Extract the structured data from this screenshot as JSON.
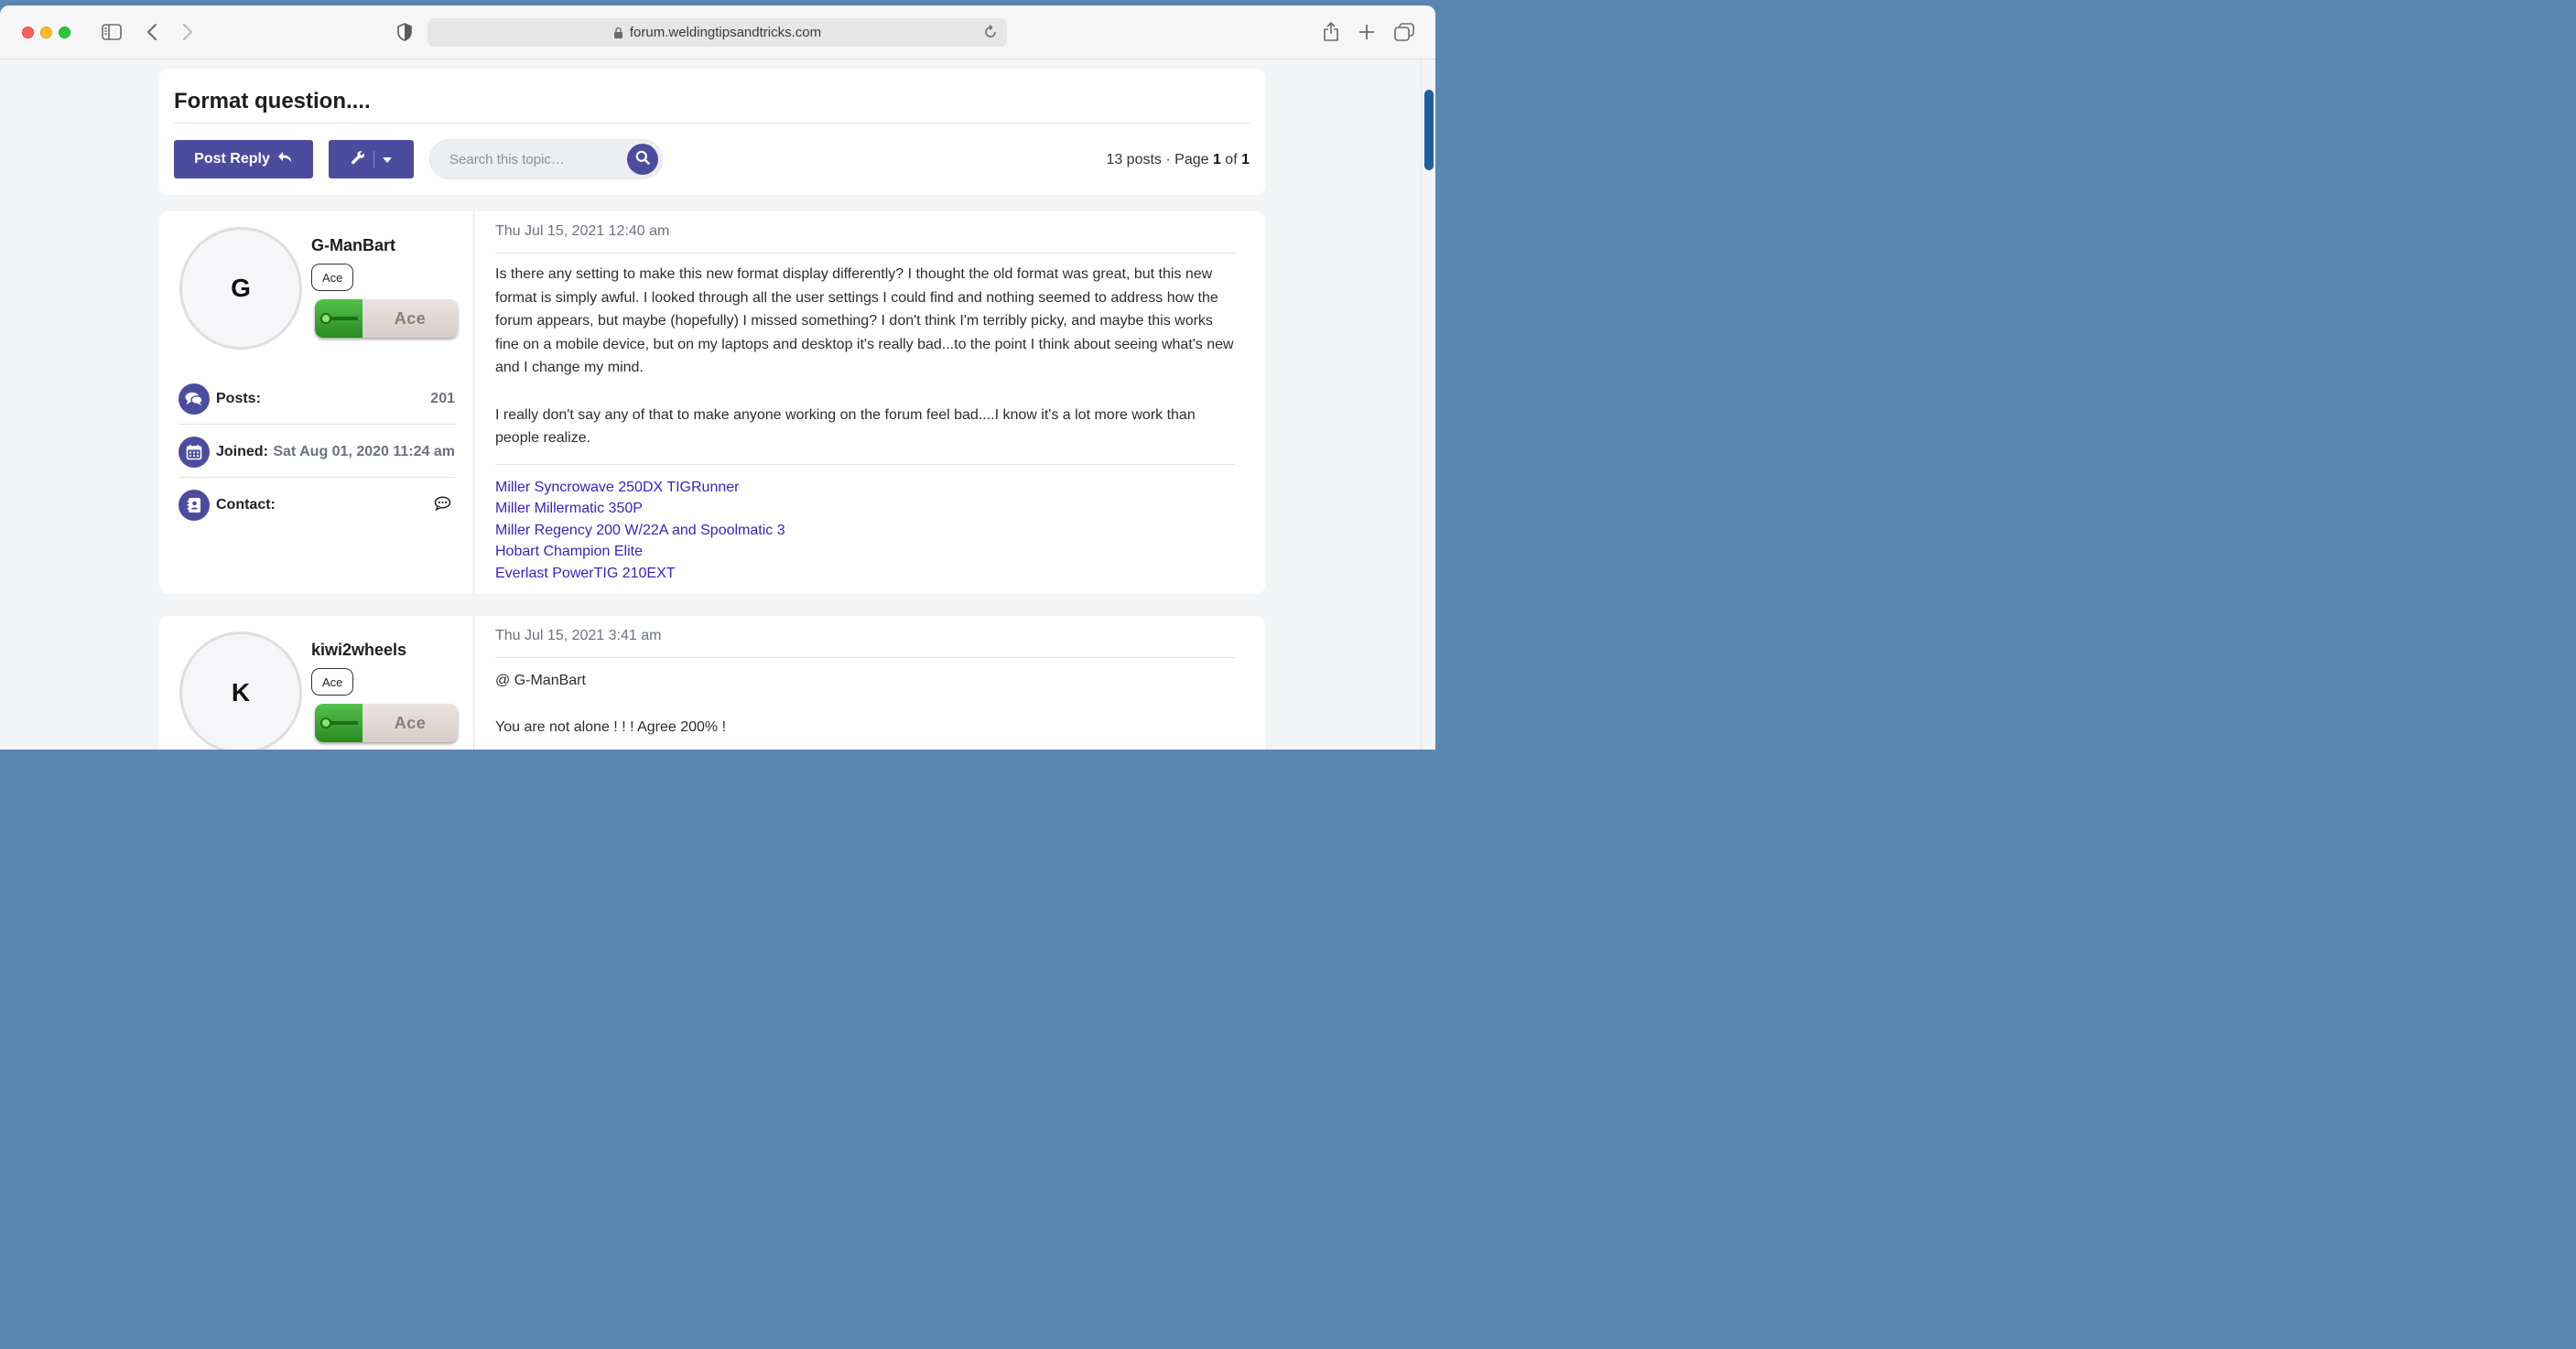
{
  "browser": {
    "url": "forum.weldingtipsandtricks.com"
  },
  "topic": {
    "title": "Format question....",
    "post_reply_label": "Post Reply",
    "search_placeholder": "Search this topic…",
    "pagination": {
      "posts": "13 posts",
      "sep": " · Page ",
      "page": "1",
      "of": " of ",
      "total": "1"
    }
  },
  "posts": [
    {
      "avatar_letter": "G",
      "username": "G-ManBart",
      "rank": "Ace",
      "rank_image_label": "Ace",
      "stats": {
        "posts_label": "Posts:",
        "posts_value": "201",
        "joined_label": "Joined:",
        "joined_value": "Sat Aug 01, 2020 11:24 am",
        "contact_label": "Contact:"
      },
      "date": "Thu Jul 15, 2021 12:40 am",
      "paragraphs": [
        "Is there any setting to make this new format display differently? I thought the old format was great, but this new format is simply awful. I looked through all the user settings I could find and nothing seemed to address how the forum appears, but maybe (hopefully) I missed something? I don't think I'm terribly picky, and maybe this works fine on a mobile device, but on my laptops and desktop it's really bad...to the point I think about seeing what's new and I change my mind.",
        "I really don't say any of that to make anyone working on the forum feel bad....I know it's a lot more work than people realize."
      ],
      "signature": [
        "Miller Syncrowave 250DX TIGRunner",
        "Miller Millermatic 350P",
        "Miller Regency 200 W/22A and Spoolmatic 3",
        "Hobart Champion Elite",
        "Everlast PowerTIG 210EXT"
      ]
    },
    {
      "avatar_letter": "K",
      "username": "kiwi2wheels",
      "rank": "Ace",
      "rank_image_label": "Ace",
      "date": "Thu Jul 15, 2021 3:41 am",
      "paragraphs": [
        "@ G-ManBart",
        "You are not alone ! ! ! Agree 200% !"
      ]
    }
  ],
  "colors": {
    "accent": "#4c4c9f",
    "link": "#3a1fc4",
    "scrollbar": "#1f5e9c"
  }
}
